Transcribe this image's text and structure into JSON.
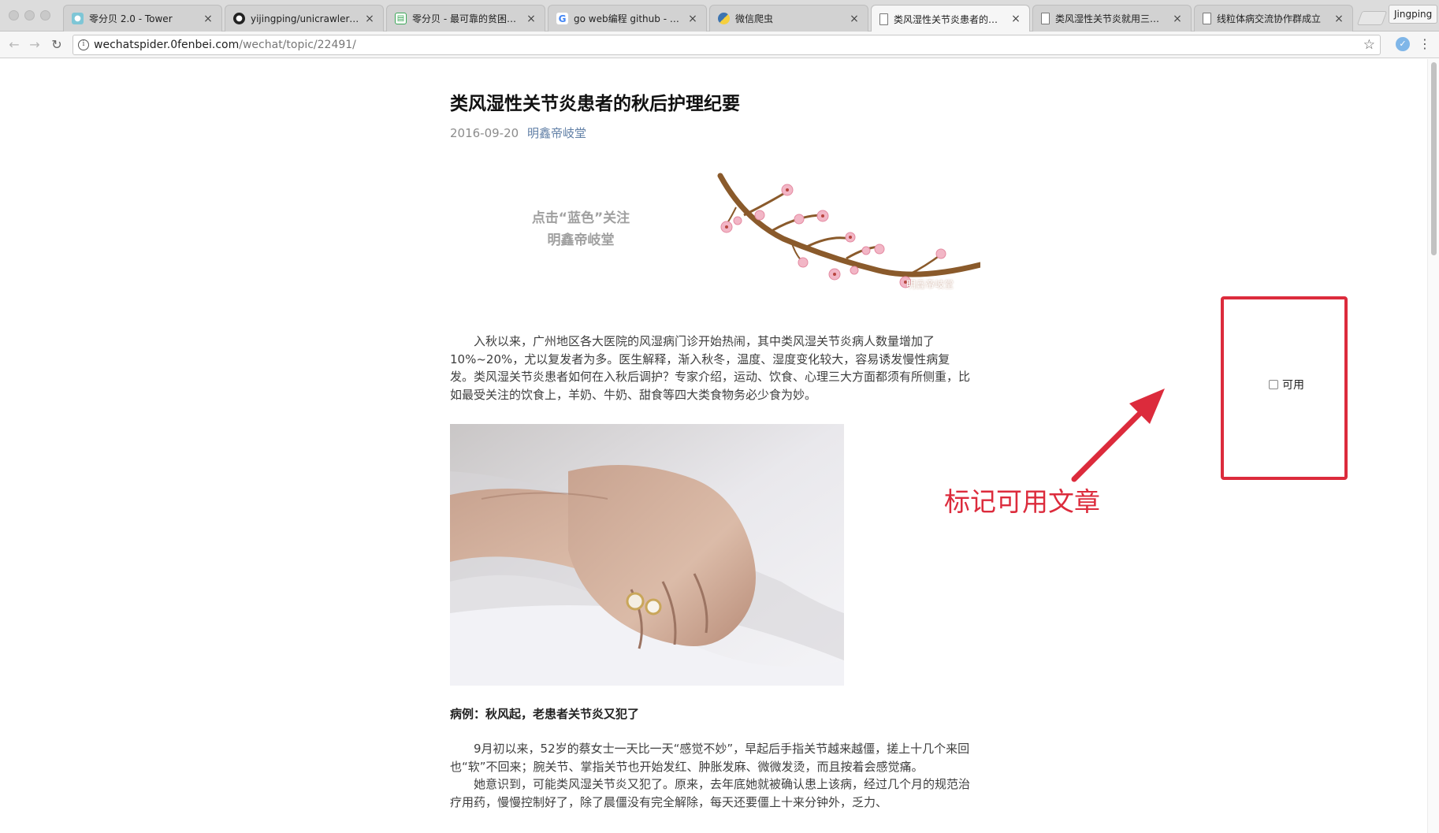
{
  "browser": {
    "tabs": [
      {
        "title": "零分贝 2.0 - Tower",
        "favicon": "tower-icon"
      },
      {
        "title": "yijingping/unicrawler: 一个",
        "favicon": "github-icon"
      },
      {
        "title": "零分贝 - 最可靠的贫困户信息",
        "favicon": "doc-icon"
      },
      {
        "title": "go web编程 github - Googl",
        "favicon": "google-icon"
      },
      {
        "title": "微信爬虫",
        "favicon": "python-icon"
      },
      {
        "title": "类风湿性关节炎患者的秋后护",
        "favicon": "page-icon",
        "active": true
      },
      {
        "title": "类风湿性关节炎就用三七治疗",
        "favicon": "page-icon"
      },
      {
        "title": "线粒体病交流协作群成立",
        "favicon": "page-icon"
      }
    ],
    "profile_name": "Jingping",
    "url_host": "wechatspider.0fenbei.com",
    "url_path": "/wechat/topic/22491/"
  },
  "article": {
    "title": "类风湿性关节炎患者的秋后护理纪要",
    "date": "2016-09-20",
    "author": "明鑫帝岐堂",
    "follow_line1": "点击“蓝色”关注",
    "follow_line2": "明鑫帝岐堂",
    "banner_watermark": "明鑫帝岐堂",
    "intro": "入秋以来，广州地区各大医院的风湿病门诊开始热闹，其中类风湿关节炎病人数量增加了10%~20%，尤以复发者为多。医生解释，渐入秋冬，温度、湿度变化较大，容易诱发慢性病复发。类风湿关节炎患者如何在入秋后调护？专家介绍，运动、饮食、心理三大方面都须有所侧重，比如最受关注的饮食上，羊奶、牛奶、甜食等四大类食物务必少食为妙。",
    "case_heading": "病例：秋风起，老患者关节炎又犯了",
    "case_p1": "9月初以来，52岁的蔡女士一天比一天“感觉不妙”，早起后手指关节越来越僵，搓上十几个来回也“软”不回来；腕关节、掌指关节也开始发红、肿胀发麻、微微发烫，而且按着会感觉痛。",
    "case_p2": "她意识到，可能类风湿关节炎又犯了。原来，去年底她就被确认患上该病，经过几个月的规范治疗用药，慢慢控制好了，除了晨僵没有完全解除，每天还要僵上十来分钟外，乏力、"
  },
  "sidebar": {
    "checkbox_label": "可用",
    "checked": false
  },
  "annotation": {
    "text": "标记可用文章",
    "color": "#dc2b3c"
  }
}
